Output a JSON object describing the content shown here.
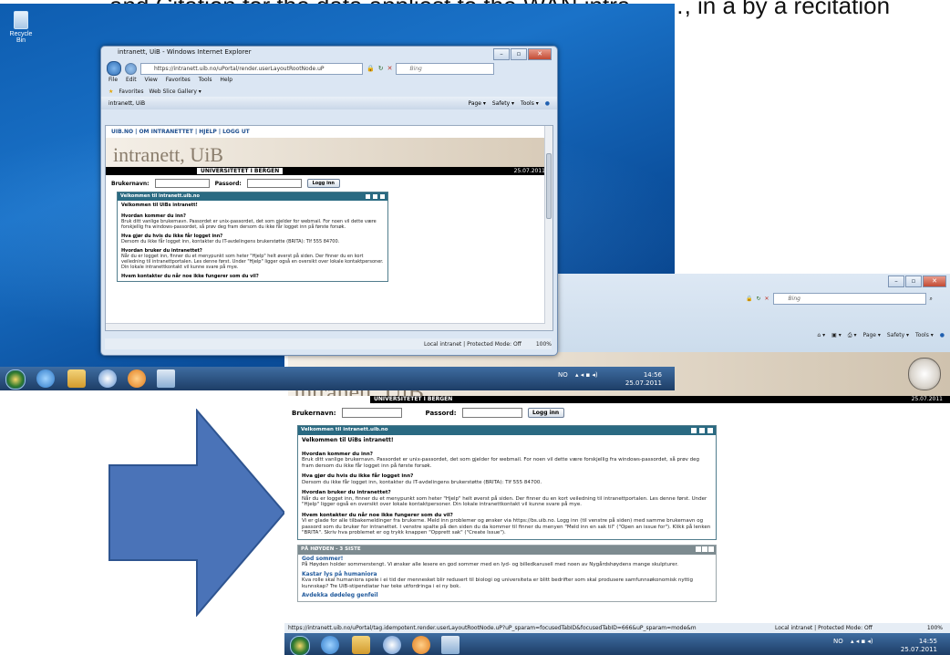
{
  "caption": "and Citation for the data appliest to the WAN intra… …, in a by a recitation",
  "desktop_small": {
    "recycle_bin_label": "Recycle Bin",
    "window_title": "intranett, UiB - Windows Internet Explorer",
    "address": "https://intranett.uib.no/uPortal/render.userLayoutRootNode.uP",
    "search_placeholder": "Bing",
    "menu": [
      "File",
      "Edit",
      "View",
      "Favorites",
      "Tools",
      "Help"
    ],
    "favorites_label": "Favorites",
    "web_slice_gallery": "Web Slice Gallery ▾",
    "tab_label": "intranett, UiB",
    "command_bar": [
      "Page ▾",
      "Safety ▾",
      "Tools ▾"
    ],
    "status_zone": "Local intranet | Protected Mode: Off",
    "status_zoom": "100%",
    "tray_lang": "NO",
    "tray_time": "14:56",
    "tray_date": "25.07.2011"
  },
  "desktop_big": {
    "search_placeholder": "Bing",
    "command_bar": [
      "Page ▾",
      "Safety ▾",
      "Tools ▾"
    ],
    "status_url": "https://intranett.uib.no/uPortal/tag.idempotent.render.userLayoutRootNode.uP?uP_sparam=focusedTabID&focusedTabID=666&uP_sparam=mode&m",
    "status_zone": "Local intranet | Protected Mode: Off",
    "status_zoom": "100%",
    "tray_lang": "NO",
    "tray_time": "14:55",
    "tray_date": "25.07.2011"
  },
  "web": {
    "top_links": "UIB.NO | OM INTRANETTET | HJELP | LOGG UT",
    "site_title": "intranett, UiB",
    "university": "UNIVERSITETET I BERGEN",
    "date": "25.07.2011",
    "username_label": "Brukernavn:",
    "password_label": "Passord:",
    "login_button": "Logg inn",
    "portlet_title": "Velkommen til intranett.uib.no",
    "welcome": "Velkommen til UiBs intranett!",
    "q1": "Hvordan kommer du inn?",
    "a1": "Bruk ditt vanlige brukernavn. Passordet er unix-passordet, det som gjelder for webmail. For noen vil dette være forskjellig fra windows-passordet, så prøv deg fram dersom du ikke får logget inn på første forsøk.",
    "q2": "Hva gjør du hvis du ikke får logget inn?",
    "a2": "Dersom du ikke får logget inn, kontakter du IT-avdelingens brukerstøtte (BRITA): Tlf 555 84700.",
    "q3": "Hvordan bruker du intranettet?",
    "a3": "Når du er logget inn, finner du et menypunkt som heter \"Hjelp\" helt øverst på siden. Der finner du en kort veiledning til intranettportalen. Les denne først. Under \"Hjelp\" ligger også en oversikt over lokale kontaktpersoner. Din lokale intranettkontakt vil kunne svare på mye.",
    "q4": "Hvem kontakter du når noe ikke fungerer som du vil?",
    "a4": "Vi er glade for alle tilbakemeldinger fra brukerne. Meld inn problemer og ønsker via https://bs.uib.no. Logg inn (til venstre på siden) med samme brukernavn og passord som du bruker for intranettet. I venstre spalte på den siden du da kommer til finner du menyen \"Meld inn en sak til\" (\"Open an issue for\"). Klikk på lenken \"BRITA\". Skriv hva problemet er og trykk knappen \"Opprett sak\" (\"Create Issue\").",
    "news_section": "PÅ HØYDEN - 3 SISTE",
    "news1_title": "God sommer!",
    "news1_text": "På Høyden holder sommerstengt. Vi ønsker alle lesere en god sommer med en lyd- og billedkarusell med noen av Nygårdshøydens mange skulpturer.",
    "news2_title": "Kastar lys på humaniora",
    "news2_text": "Kva rolle skal humaniora spele i ei tid der mennesket blir redusert til biologi og universiteta er blitt bedrifter som skal produsere samfunnsøkonomisk nyttig kunnskap? Tre UiB-stipendiatar har teke utfordringa i ei ny bok.",
    "news3_title": "Avdekka dødeleg genfeil"
  },
  "colors": {
    "desktop_blue": "#1a72c8",
    "arrow_blue": "#4a73b8",
    "arrow_orange": "#f08a24",
    "portlet_head": "#2a6a82"
  }
}
